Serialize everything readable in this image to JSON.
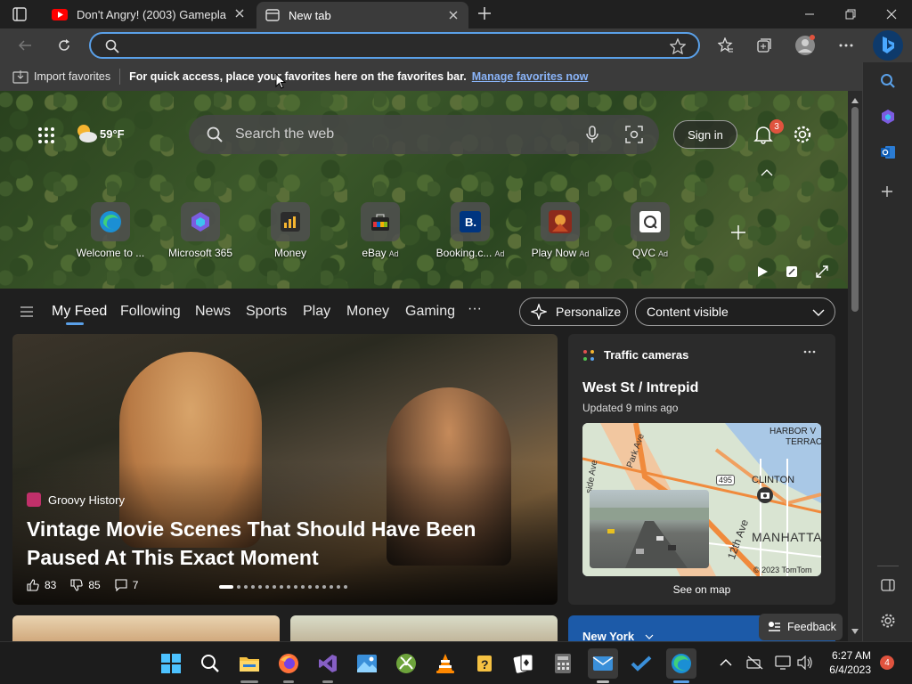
{
  "tabs": [
    {
      "title": "Don't Angry! (2003) Gameplay - ",
      "icon": "youtube-icon"
    },
    {
      "title": "New tab",
      "icon": "new-tab-page-icon"
    }
  ],
  "address": {
    "value": ""
  },
  "favorites_bar": {
    "import_label": "Import favorites",
    "message": "For quick access, place your favorites here on the favorites bar.",
    "link": "Manage favorites now"
  },
  "weather": {
    "temp": "59°F"
  },
  "search": {
    "placeholder": "Search the web"
  },
  "header": {
    "signin": "Sign in",
    "notification_count": "3"
  },
  "quick_links": [
    {
      "label": "Welcome to ...",
      "ad": "",
      "icon": "edge-icon"
    },
    {
      "label": "Microsoft 365",
      "ad": "",
      "icon": "microsoft-365-icon"
    },
    {
      "label": "Money",
      "ad": "",
      "icon": "money-icon"
    },
    {
      "label": "eBay",
      "ad": "Ad",
      "icon": "ebay-icon"
    },
    {
      "label": "Booking.c...",
      "ad": "Ad",
      "icon": "booking-icon"
    },
    {
      "label": "Play Now",
      "ad": "Ad",
      "icon": "play-now-icon"
    },
    {
      "label": "QVC",
      "ad": "Ad",
      "icon": "qvc-icon"
    }
  ],
  "nav": {
    "items": [
      "My Feed",
      "Following",
      "News",
      "Sports",
      "Play",
      "Money",
      "Gaming"
    ],
    "more": "···",
    "personalize": "Personalize",
    "content_visible": "Content visible"
  },
  "story": {
    "source": "Groovy History",
    "headline": "Vintage Movie Scenes That Should Have Been Paused At This Exact Moment",
    "likes": "83",
    "dislikes": "85",
    "comments": "7"
  },
  "traffic": {
    "title": "Traffic cameras",
    "location": "West St / Intrepid",
    "updated": "Updated 9 mins ago",
    "map_labels": {
      "park_ave": "Park Ave",
      "side_ave": "side Ave",
      "harbor": "HARBOR V",
      "terrace": "TERRAC",
      "clinton": "CLINTON",
      "route": "495",
      "twelfth": "12th Ave",
      "manhattan": "MANHATTA",
      "copyright": "© 2023 TomTom"
    },
    "see_map": "See on map"
  },
  "lower": {
    "newyork": "New York"
  },
  "feedback": "Feedback",
  "clock": {
    "time": "6:27 AM",
    "date": "6/4/2023"
  },
  "taskbar_notif": "4",
  "colors": {
    "accent": "#5aa0e8",
    "badge": "#e0533e",
    "link": "#8ab4f8"
  }
}
